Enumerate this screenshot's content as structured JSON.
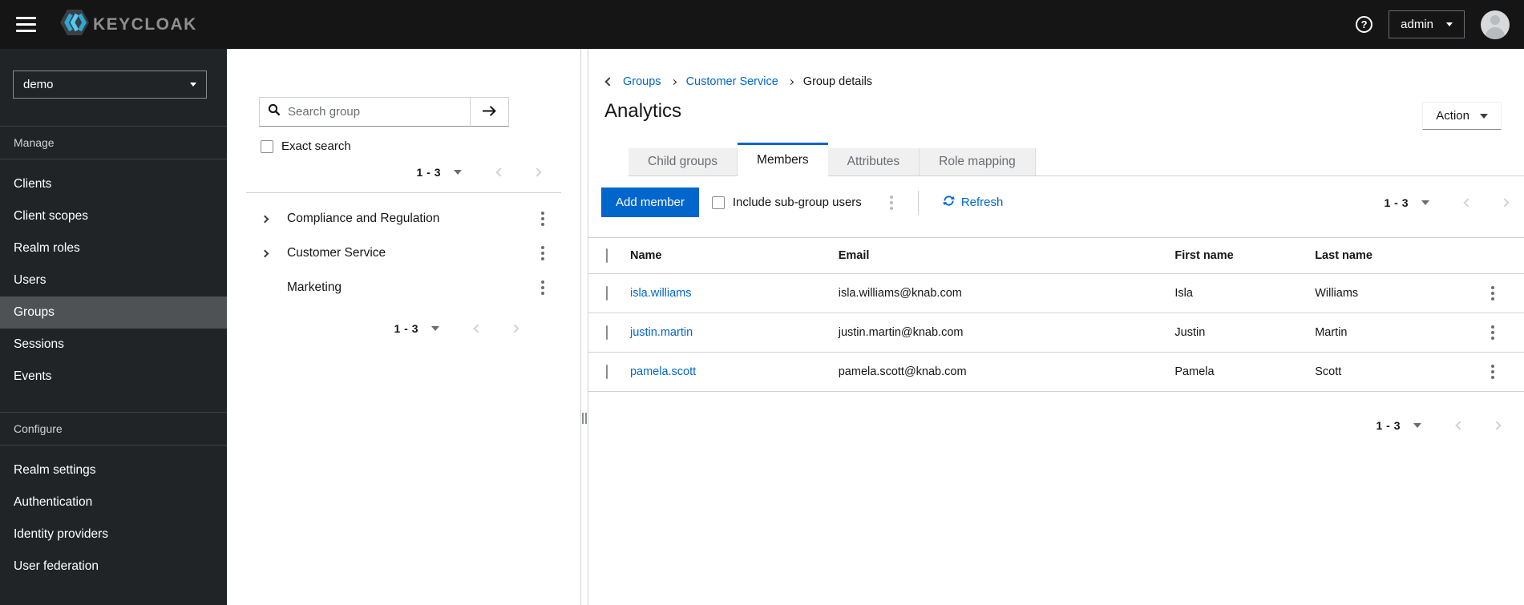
{
  "topbar": {
    "logo_text": "KEYCLOAK",
    "help_glyph": "?",
    "user_menu_label": "admin"
  },
  "sidebar": {
    "realm": "demo",
    "sections": [
      {
        "label": "Manage",
        "items": [
          {
            "label": "Clients"
          },
          {
            "label": "Client scopes"
          },
          {
            "label": "Realm roles"
          },
          {
            "label": "Users"
          },
          {
            "label": "Groups",
            "active": true
          },
          {
            "label": "Sessions"
          },
          {
            "label": "Events"
          }
        ]
      },
      {
        "label": "Configure",
        "items": [
          {
            "label": "Realm settings"
          },
          {
            "label": "Authentication"
          },
          {
            "label": "Identity providers"
          },
          {
            "label": "User federation"
          }
        ]
      }
    ]
  },
  "tree_panel": {
    "search_placeholder": "Search group",
    "exact_search_label": "Exact search",
    "pagination_top": "1 - 3",
    "pagination_bottom": "1 - 3",
    "groups": [
      {
        "label": "Compliance and Regulation",
        "expandable": true
      },
      {
        "label": "Customer Service",
        "expandable": true
      },
      {
        "label": "Marketing",
        "expandable": false
      }
    ]
  },
  "main": {
    "breadcrumb": {
      "groups": "Groups",
      "parent": "Customer Service",
      "current": "Group details"
    },
    "title": "Analytics",
    "action_label": "Action",
    "tabs": [
      {
        "label": "Child groups"
      },
      {
        "label": "Members",
        "active": true
      },
      {
        "label": "Attributes"
      },
      {
        "label": "Role mapping"
      }
    ],
    "toolbar": {
      "add_member": "Add member",
      "include_subgroups": "Include sub-group users",
      "refresh": "Refresh",
      "pagination": "1 - 3"
    },
    "table": {
      "columns": [
        "Name",
        "Email",
        "First name",
        "Last name"
      ],
      "rows": [
        {
          "name": "isla.williams",
          "email": "isla.williams@knab.com",
          "first": "Isla",
          "last": "Williams"
        },
        {
          "name": "justin.martin",
          "email": "justin.martin@knab.com",
          "first": "Justin",
          "last": "Martin"
        },
        {
          "name": "pamela.scott",
          "email": "pamela.scott@knab.com",
          "first": "Pamela",
          "last": "Scott"
        }
      ]
    },
    "pagination_bottom": "1 - 3"
  },
  "colors": {
    "accent_blue": "#0066cc",
    "topbar_bg": "#151515",
    "sidebar_bg": "#212427",
    "sidebar_active_bg": "#4f5255",
    "border_light": "#d2d2d2",
    "text_muted": "#6a6e73",
    "logo_cyan": "#3cb4dc"
  }
}
